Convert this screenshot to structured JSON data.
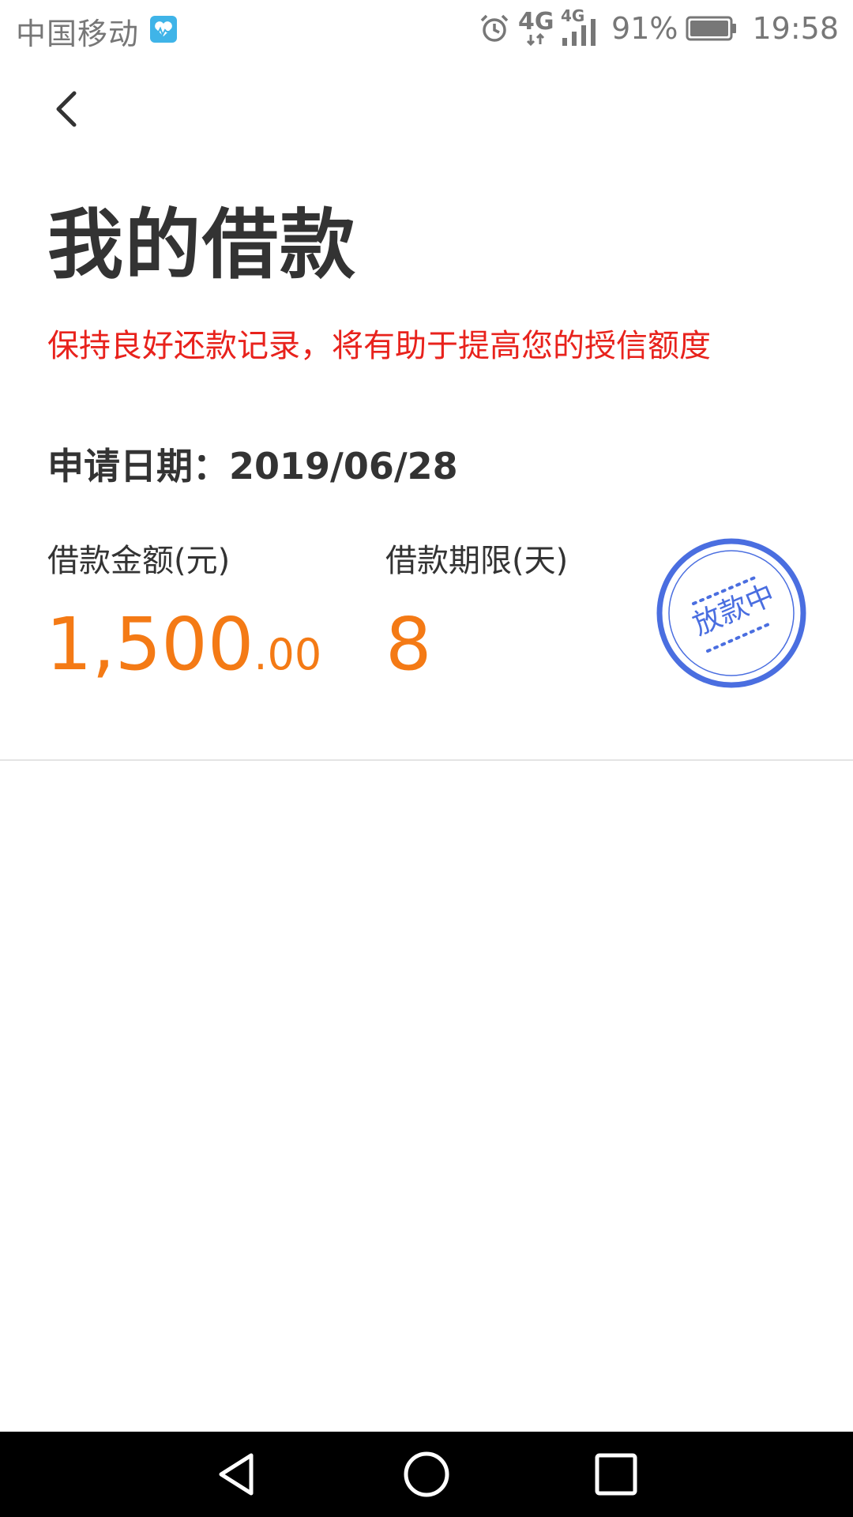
{
  "status_bar": {
    "carrier": "中国移动",
    "network_1": "4G",
    "network_2": "4G",
    "battery_percent": "91%",
    "time": "19:58",
    "icons": [
      "health-icon",
      "alarm-icon",
      "data-4g-icon",
      "signal-icon",
      "battery-icon"
    ]
  },
  "header": {
    "back_icon": "back-arrow-icon"
  },
  "page": {
    "title": "我的借款",
    "subtitle": "保持良好还款记录，将有助于提高您的授信额度"
  },
  "loan": {
    "apply_date_label": "申请日期：",
    "apply_date": "2019/06/28",
    "amount_label": "借款金额(元)",
    "amount_integer": "1,500",
    "amount_decimal": ".00",
    "term_label": "借款期限(天)",
    "term_value": "8",
    "status_stamp": "放款中"
  },
  "colors": {
    "accent_orange": "#f47a15",
    "warning_red": "#e8221c",
    "stamp_blue": "#4a6ee0",
    "text_dark": "#333333"
  },
  "nav_bar": {
    "icons": [
      "nav-back-icon",
      "nav-home-icon",
      "nav-recent-icon"
    ]
  }
}
